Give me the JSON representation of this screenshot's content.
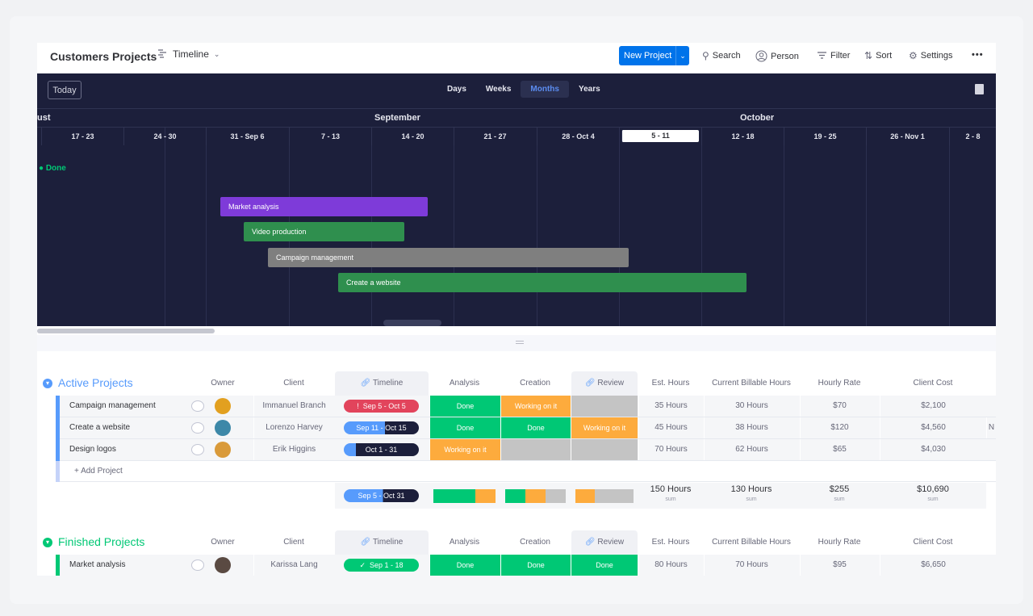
{
  "header": {
    "board_title": "Customers Projects",
    "view_label": "Timeline",
    "new_button": "New Project",
    "search": "Search",
    "person": "Person",
    "filter": "Filter",
    "sort": "Sort",
    "settings": "Settings",
    "more": "•••"
  },
  "timeline": {
    "today_button": "Today",
    "scales": [
      "Days",
      "Weeks",
      "Months",
      "Years"
    ],
    "active_scale": "Months",
    "months": [
      "ust",
      "September",
      "October"
    ],
    "weeks": [
      "17 - 23",
      "24 - 30",
      "31 - Sep 6",
      "7 - 13",
      "14 - 20",
      "21 - 27",
      "28 - Oct 4",
      "5 - 11",
      "12 - 18",
      "19 - 25",
      "26 - Nov 1",
      "2 - 8"
    ],
    "current_week": "5 - 11",
    "group_label": "● Done",
    "bars": [
      {
        "label": "Market analysis",
        "color": "#7e3bd9"
      },
      {
        "label": "Video production",
        "color": "#2f8f4e"
      },
      {
        "label": "Campaign management",
        "color": "#7f7f7f"
      },
      {
        "label": "Create a website",
        "color": "#2f8f4e"
      }
    ]
  },
  "columns": {
    "owner": "Owner",
    "client": "Client",
    "timeline": "Timeline",
    "analysis": "Analysis",
    "creation": "Creation",
    "review": "Review",
    "est_hours": "Est. Hours",
    "billable": "Current Billable Hours",
    "rate": "Hourly Rate",
    "cost": "Client Cost"
  },
  "active": {
    "title": "Active Projects",
    "color": "#579bfc",
    "rows": [
      {
        "name": "Campaign management",
        "client": "Immanuel Branch",
        "timeline": "Sep 5 - Oct 5",
        "analysis": "Done",
        "creation": "Working on it",
        "review": "",
        "est": "35 Hours",
        "billable": "30 Hours",
        "rate": "$70",
        "cost": "$2,100"
      },
      {
        "name": "Create a website",
        "client": "Lorenzo Harvey",
        "timeline": "Sep 11 - Oct 15",
        "analysis": "Done",
        "creation": "Done",
        "review": "Working on it",
        "est": "45 Hours",
        "billable": "38 Hours",
        "rate": "$120",
        "cost": "$4,560",
        "extra": "N"
      },
      {
        "name": "Design logos",
        "client": "Erik Higgins",
        "timeline": "Oct 1 - 31",
        "analysis": "Working on it",
        "creation": "",
        "review": "",
        "est": "70 Hours",
        "billable": "62 Hours",
        "rate": "$65",
        "cost": "$4,030"
      }
    ],
    "add_label": "+ Add Project",
    "summary": {
      "timeline": "Sep 5 - Oct 31",
      "est": "150 Hours",
      "billable": "130 Hours",
      "rate": "$255",
      "cost": "$10,690",
      "sub": "sum"
    }
  },
  "finished": {
    "title": "Finished Projects",
    "color": "#00c875",
    "rows": [
      {
        "name": "Market analysis",
        "client": "Karissa Lang",
        "timeline": "Sep 1 - 18",
        "analysis": "Done",
        "creation": "Done",
        "review": "Done",
        "est": "80 Hours",
        "billable": "70 Hours",
        "rate": "$95",
        "cost": "$6,650"
      }
    ]
  },
  "colors": {
    "done": "#00c875",
    "working": "#fdab3d",
    "empty": "#c4c4c4",
    "stuck": "#e2445c",
    "navy": "#1c1f3b",
    "primary": "#0073ea"
  }
}
